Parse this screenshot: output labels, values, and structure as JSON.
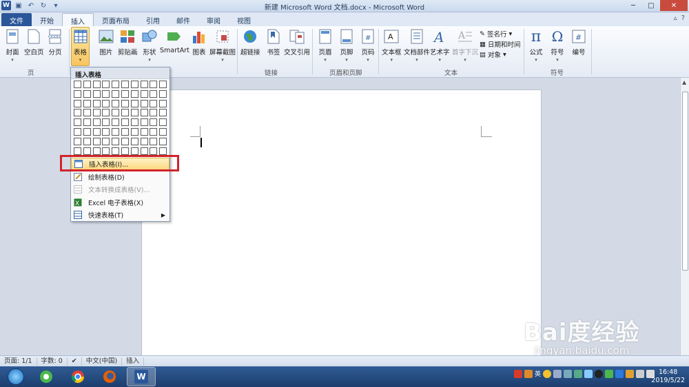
{
  "window": {
    "title": "新建 Microsoft Word 文档.docx - Microsoft Word"
  },
  "tabs": [
    {
      "label": "文件"
    },
    {
      "label": "开始"
    },
    {
      "label": "插入"
    },
    {
      "label": "页面布局"
    },
    {
      "label": "引用"
    },
    {
      "label": "邮件"
    },
    {
      "label": "审阅"
    },
    {
      "label": "视图"
    }
  ],
  "ribbon": {
    "page_group": {
      "label": "页",
      "cover": "封面",
      "blank": "空白页",
      "break": "分页"
    },
    "table_button": "表格",
    "illus": {
      "picture": "图片",
      "clipart": "剪贴画",
      "shapes": "形状",
      "smartart": "SmartArt",
      "chart": "图表",
      "screenshot": "屏幕截图"
    },
    "links_group": {
      "label": "链接",
      "hyperlink": "超链接",
      "bookmark": "书签",
      "crossref": "交叉引用"
    },
    "hf_group": {
      "label": "页眉和页脚",
      "header": "页眉",
      "footer": "页脚",
      "pagenum": "页码"
    },
    "text_group": {
      "label": "文本",
      "textbox": "文本框",
      "quickparts": "文档部件",
      "wordart": "艺术字",
      "dropcap": "首字下沉",
      "sigline": "签名行",
      "datetime": "日期和时间",
      "object": "对象"
    },
    "symbols_group": {
      "label": "符号",
      "equation": "公式",
      "symbol": "符号",
      "number": "编号"
    }
  },
  "dropdown": {
    "title": "插入表格",
    "items": [
      {
        "label": "插入表格(I)..."
      },
      {
        "label": "绘制表格(D)"
      },
      {
        "label": "文本转换成表格(V)..."
      },
      {
        "label": "Excel 电子表格(X)"
      },
      {
        "label": "快速表格(T)"
      }
    ]
  },
  "status": {
    "page": "页面: 1/1",
    "words": "字数: 0",
    "lang": "中文(中国)",
    "mode": "插入"
  },
  "clock": {
    "time": "16:48",
    "date": "2019/5/22"
  },
  "tray_ime": "英",
  "watermark": {
    "brand": "Bai度经验",
    "url": "jingyan.baidu.com"
  },
  "colors": {
    "accent": "#2b579a",
    "highlight": "#fbd880",
    "redbox": "#d2232a"
  }
}
